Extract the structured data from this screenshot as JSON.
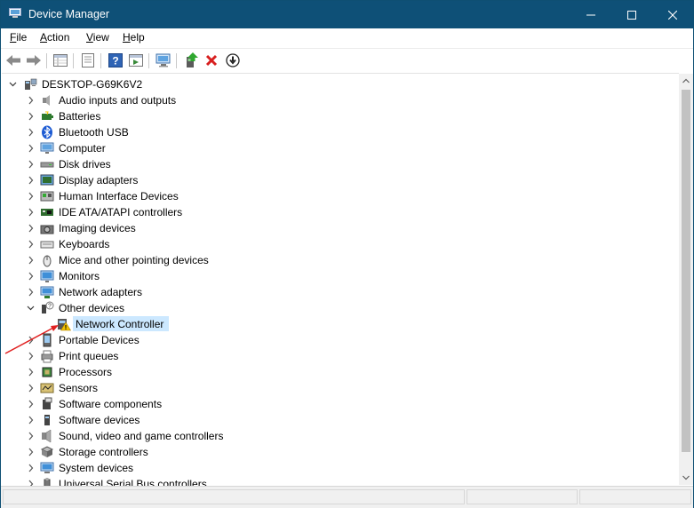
{
  "window": {
    "title": "Device Manager",
    "accent": "#0e5077"
  },
  "menu": [
    {
      "label": "File",
      "ul": "F",
      "rest": "ile"
    },
    {
      "label": "Action",
      "ul": "A",
      "rest": "ction"
    },
    {
      "label": "View",
      "ul": "V",
      "rest": "iew"
    },
    {
      "label": "Help",
      "ul": "H",
      "rest": "elp"
    }
  ],
  "toolbar": {
    "icons": [
      "back-arrow-icon",
      "forward-arrow-icon",
      "properties-grid-icon",
      "properties-page-icon",
      "help-icon",
      "run-icon",
      "scan-hardware-icon",
      "update-driver-icon",
      "uninstall-icon",
      "disable-icon"
    ]
  },
  "tree": {
    "root": "DESKTOP-G69K6V2",
    "categories": [
      {
        "label": "Audio inputs and outputs",
        "icon": "speaker-icon",
        "expanded": false
      },
      {
        "label": "Batteries",
        "icon": "battery-icon",
        "expanded": false
      },
      {
        "label": "Bluetooth USB",
        "icon": "bluetooth-icon",
        "expanded": false
      },
      {
        "label": "Computer",
        "icon": "computer-icon",
        "expanded": false
      },
      {
        "label": "Disk drives",
        "icon": "disk-drive-icon",
        "expanded": false
      },
      {
        "label": "Display adapters",
        "icon": "display-adapter-icon",
        "expanded": false
      },
      {
        "label": "Human Interface Devices",
        "icon": "hid-icon",
        "expanded": false
      },
      {
        "label": "IDE ATA/ATAPI controllers",
        "icon": "ide-controller-icon",
        "expanded": false
      },
      {
        "label": "Imaging devices",
        "icon": "camera-icon",
        "expanded": false
      },
      {
        "label": "Keyboards",
        "icon": "keyboard-icon",
        "expanded": false
      },
      {
        "label": "Mice and other pointing devices",
        "icon": "mouse-icon",
        "expanded": false
      },
      {
        "label": "Monitors",
        "icon": "monitor-icon",
        "expanded": false
      },
      {
        "label": "Network adapters",
        "icon": "network-adapter-icon",
        "expanded": false
      },
      {
        "label": "Other devices",
        "icon": "unknown-device-icon",
        "expanded": true,
        "children": [
          {
            "label": "Network Controller",
            "icon": "warning-device-icon",
            "selected": true
          }
        ]
      },
      {
        "label": "Portable Devices",
        "icon": "portable-device-icon",
        "expanded": false
      },
      {
        "label": "Print queues",
        "icon": "printer-icon",
        "expanded": false
      },
      {
        "label": "Processors",
        "icon": "processor-icon",
        "expanded": false
      },
      {
        "label": "Sensors",
        "icon": "sensor-icon",
        "expanded": false
      },
      {
        "label": "Software components",
        "icon": "software-component-icon",
        "expanded": false
      },
      {
        "label": "Software devices",
        "icon": "software-device-icon",
        "expanded": false
      },
      {
        "label": "Sound, video and game controllers",
        "icon": "sound-icon",
        "expanded": false
      },
      {
        "label": "Storage controllers",
        "icon": "storage-controller-icon",
        "expanded": false
      },
      {
        "label": "System devices",
        "icon": "system-device-icon",
        "expanded": false
      },
      {
        "label": "Universal Serial Bus controllers",
        "icon": "usb-icon",
        "expanded": false
      }
    ]
  },
  "annotation": {
    "color": "#e02020",
    "label": ""
  }
}
